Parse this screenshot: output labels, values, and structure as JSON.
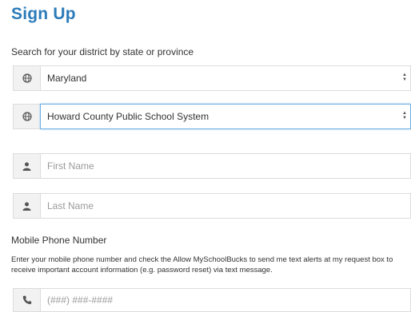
{
  "page": {
    "title": "Sign Up"
  },
  "district": {
    "label": "Search for your district by state or province",
    "state_value": "Maryland",
    "district_value": "Howard County Public School System"
  },
  "name": {
    "first_placeholder": "First Name",
    "last_placeholder": "Last Name"
  },
  "phone": {
    "label": "Mobile Phone Number",
    "description": "Enter your mobile phone number and check the Allow MySchoolBucks to send me text alerts at my request box to receive important account information (e.g. password reset) via text message.",
    "placeholder": "(###) ###-####"
  },
  "icons": {
    "state": "globe-icon",
    "district": "globe-icon",
    "first_name": "user-icon",
    "last_name": "user-icon",
    "phone": "phone-icon"
  },
  "colors": {
    "title": "#2b7bb9",
    "focus_border": "#6aaee3",
    "addon_bg": "#f2f2f2"
  }
}
